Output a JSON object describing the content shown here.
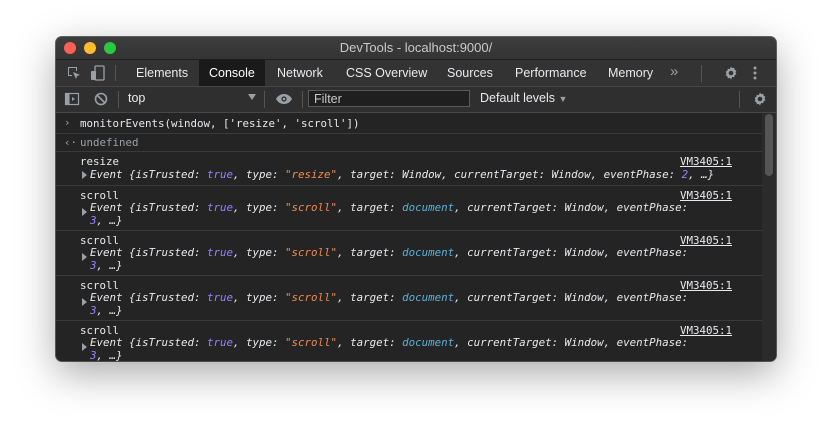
{
  "window": {
    "title": "DevTools - localhost:9000/"
  },
  "tabs": [
    "Elements",
    "Console",
    "Network",
    "CSS Overview",
    "Sources",
    "Performance",
    "Memory"
  ],
  "active_tab": "Console",
  "toolbar": {
    "context": "top",
    "filter_placeholder": "Filter",
    "levels": "Default levels"
  },
  "console": {
    "command": "monitorEvents(window, ['resize', 'scroll'])",
    "result": "undefined",
    "entries": [
      {
        "name": "resize",
        "source": "VM3405:1",
        "line1": {
          "pre": "Event {isTrusted: ",
          "bool": "true",
          "mid": ", type: ",
          "str": "\"resize\"",
          "post": ", target: Window, currentTarget: Window, eventPhase: ",
          "num": "2",
          "tail": ", …}"
        }
      },
      {
        "name": "scroll",
        "source": "VM3405:1",
        "line1": {
          "pre": "Event {isTrusted: ",
          "bool": "true",
          "mid": ", type: ",
          "str": "\"scroll\"",
          "mid2": ", target: ",
          "ref": "document",
          "post": ", currentTarget: Window, eventPhase:"
        },
        "line2": {
          "num": "3",
          "tail": ", …}"
        }
      },
      {
        "name": "scroll",
        "source": "VM3405:1",
        "line1": {
          "pre": "Event {isTrusted: ",
          "bool": "true",
          "mid": ", type: ",
          "str": "\"scroll\"",
          "mid2": ", target: ",
          "ref": "document",
          "post": ", currentTarget: Window, eventPhase:"
        },
        "line2": {
          "num": "3",
          "tail": ", …}"
        }
      },
      {
        "name": "scroll",
        "source": "VM3405:1",
        "line1": {
          "pre": "Event {isTrusted: ",
          "bool": "true",
          "mid": ", type: ",
          "str": "\"scroll\"",
          "mid2": ", target: ",
          "ref": "document",
          "post": ", currentTarget: Window, eventPhase:"
        },
        "line2": {
          "num": "3",
          "tail": ", …}"
        }
      },
      {
        "name": "scroll",
        "source": "VM3405:1",
        "line1": {
          "pre": "Event {isTrusted: ",
          "bool": "true",
          "mid": ", type: ",
          "str": "\"scroll\"",
          "mid2": ", target: ",
          "ref": "document",
          "post": ", currentTarget: Window, eventPhase:"
        },
        "line2": {
          "num": "3",
          "tail": ", …}"
        }
      }
    ]
  },
  "icons": [
    "close-light",
    "minimize-light",
    "zoom-light",
    "inspect-element-icon",
    "device-toggle-icon",
    "more-tabs-icon",
    "settings-icon",
    "more-options-icon",
    "sidebar-toggle-icon",
    "clear-console-icon",
    "eye-icon",
    "console-settings-icon"
  ],
  "colors": {
    "background": "#242424",
    "keyword": "#9980ff",
    "string": "#f28b54",
    "reference": "#5db0d7"
  }
}
